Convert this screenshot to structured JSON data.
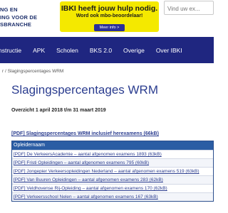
{
  "logo": {
    "lines": [
      "NG EN",
      "ING VOOR DE",
      "SBRANCHE"
    ]
  },
  "promo": {
    "headline": "IBKI heeft jouw hulp nodig.",
    "sub": "Word ook mbo-beoordelaar!",
    "more_label": "Meer info >",
    "color": "#f4e900"
  },
  "search": {
    "placeholder": "Vind uw ex..."
  },
  "nav": {
    "items": [
      "nstructie",
      "APK",
      "Scholen",
      "BKS 2.0",
      "Overige",
      "Over IBKI"
    ],
    "background": "#1f2680"
  },
  "breadcrumb": {
    "text": "r / Slagingspercentages WRM"
  },
  "page": {
    "title": "Slagingspercentages WRM",
    "period": "Overzicht 1 april 2018 t/m 31 maart 2019",
    "pdf_link": "[PDF] Slagingspercentages WRM inclusief herexamens (66kB)"
  },
  "table": {
    "header": "Opleidernaam",
    "rows": [
      "[PDF] De VerkeersAcademie – aantal afgenomen examens 1893 (63kB)",
      "[PDF] Fristi Opleidingen – aantal afgenomen examens 795 (60kB)",
      "[PDF] Jongepier Verkeersopleidingen Nederland – aantal afgenomen examens 519 (63kB)",
      "[PDF] Van Buuren Opleidingen – aantal afgenomen examens 283 (62kB)",
      "[PDF] Veldhovense Rij-Opleiding – aantal afgenomen examens 170 (62kB)",
      "[PDF] Verkeersschool Nelen – aantal afgenomen examens 167 (63kB)"
    ],
    "header_color": "#2b5da4"
  }
}
